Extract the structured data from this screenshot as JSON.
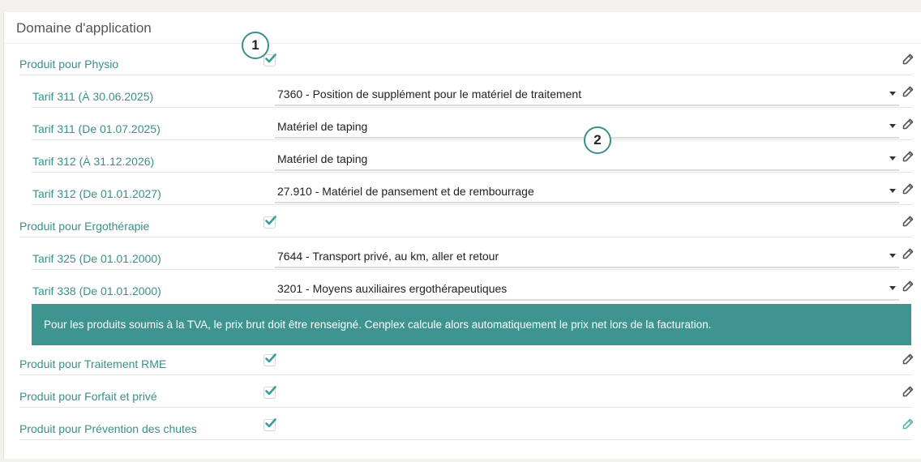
{
  "section_title": "Domaine d'application",
  "markers": [
    "1",
    "2"
  ],
  "colors": {
    "accent": "#3a8f8c",
    "banner": "#3e958f",
    "checkmark": "#3a9e98",
    "edit_icon": "#555555",
    "edit_icon_active": "#5bb3ad"
  },
  "rows": [
    {
      "kind": "product",
      "label": "Produit pour Physio",
      "checked": true,
      "icon": "pencil-icon"
    },
    {
      "kind": "tarif",
      "label": "Tarif 311 (À 30.06.2025)",
      "value": "7360 - Position de supplément pour le matériel de traitement",
      "icon": "pencil-icon"
    },
    {
      "kind": "tarif",
      "label": "Tarif 311 (De 01.07.2025)",
      "value": "Matériel de taping",
      "icon": "pencil-icon"
    },
    {
      "kind": "tarif",
      "label": "Tarif 312 (À 31.12.2026)",
      "value": "Matériel de taping",
      "icon": "pencil-icon"
    },
    {
      "kind": "tarif",
      "label": "Tarif 312 (De 01.01.2027)",
      "value": "27.910 - Matériel de pansement et de rembourrage",
      "icon": "pencil-icon"
    },
    {
      "kind": "product",
      "label": "Produit pour Ergothérapie",
      "checked": true,
      "icon": "pencil-icon"
    },
    {
      "kind": "tarif",
      "label": "Tarif 325 (De 01.01.2000)",
      "value": "7644 - Transport privé, au km, aller et retour",
      "icon": "pencil-icon"
    },
    {
      "kind": "tarif",
      "label": "Tarif 338 (De 01.01.2000)",
      "value": "3201 - Moyens auxiliaires ergothérapeutiques",
      "icon": "pencil-icon"
    },
    {
      "kind": "product",
      "label": "Produit pour Traitement RME",
      "checked": true,
      "icon": "pencil-icon"
    },
    {
      "kind": "product",
      "label": "Produit pour Forfait et privé",
      "checked": true,
      "icon": "pencil-icon"
    },
    {
      "kind": "product",
      "label": "Produit pour Prévention des chutes",
      "checked": true,
      "icon": "pencil-icon",
      "icon_active": true
    }
  ],
  "info_banner": "Pour les produits soumis à la TVA, le prix brut doit être renseigné. Cenplex calcule alors automatiquement le prix net lors de la facturation."
}
